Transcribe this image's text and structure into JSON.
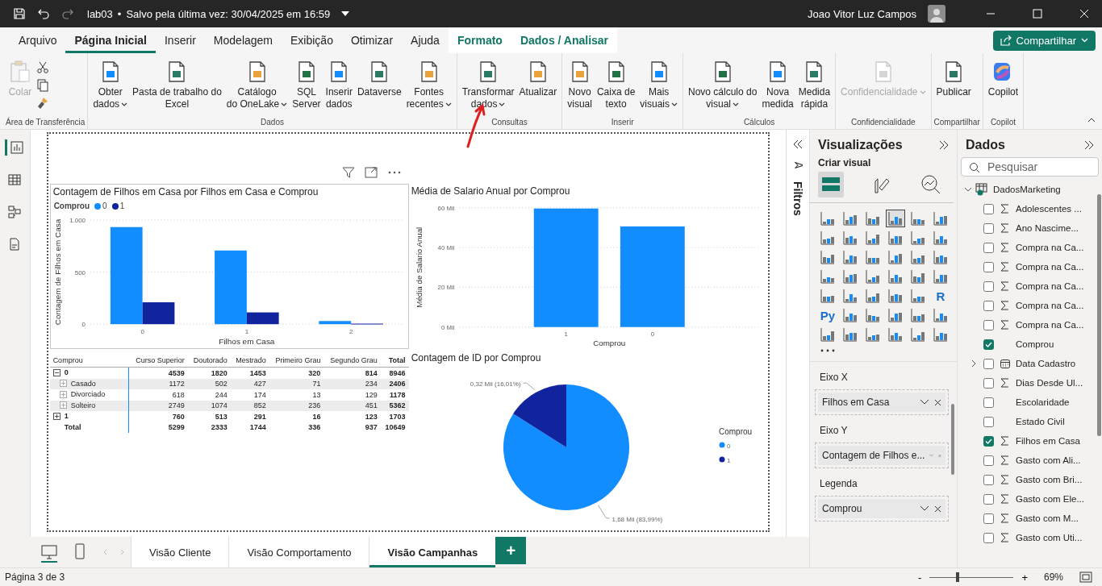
{
  "title_bar": {
    "file_name": "lab03",
    "separator": "•",
    "save_status": "Salvo pela última vez: 30/04/2025 em 16:59",
    "user_name": "Joao Vitor Luz Campos"
  },
  "menu_tabs": [
    {
      "label": "Arquivo",
      "selected": false,
      "kind": "normal"
    },
    {
      "label": "Página Inicial",
      "selected": true,
      "kind": "normal"
    },
    {
      "label": "Inserir",
      "selected": false,
      "kind": "normal"
    },
    {
      "label": "Modelagem",
      "selected": false,
      "kind": "normal"
    },
    {
      "label": "Exibição",
      "selected": false,
      "kind": "normal"
    },
    {
      "label": "Otimizar",
      "selected": false,
      "kind": "normal"
    },
    {
      "label": "Ajuda",
      "selected": false,
      "kind": "normal"
    },
    {
      "label": "Formato",
      "selected": false,
      "kind": "contextual"
    },
    {
      "label": "Dados / Analisar",
      "selected": false,
      "kind": "contextual"
    }
  ],
  "share_button": "Compartilhar",
  "ribbon_groups": [
    {
      "label": "Área de Transferência",
      "kind": "clipboard",
      "items": [
        {
          "label": "Colar",
          "disabled": true,
          "dropdown": false
        }
      ]
    },
    {
      "label": "Dados",
      "kind": "standard",
      "items": [
        {
          "label": "Obter\ndados",
          "disabled": false,
          "dropdown": true
        },
        {
          "label": "Pasta de trabalho do\nExcel",
          "disabled": false,
          "dropdown": false
        },
        {
          "label": "Catálogo\ndo OneLake",
          "disabled": false,
          "dropdown": true
        },
        {
          "label": "SQL\nServer",
          "disabled": false,
          "dropdown": false
        },
        {
          "label": "Inserir\ndados",
          "disabled": false,
          "dropdown": false
        },
        {
          "label": "Dataverse",
          "disabled": false,
          "dropdown": false
        },
        {
          "label": "Fontes\nrecentes",
          "disabled": false,
          "dropdown": true
        }
      ]
    },
    {
      "label": "Consultas",
      "kind": "standard",
      "items": [
        {
          "label": "Transformar\ndados",
          "disabled": false,
          "dropdown": true
        },
        {
          "label": "Atualizar",
          "disabled": false,
          "dropdown": false
        }
      ]
    },
    {
      "label": "Inserir",
      "kind": "standard",
      "items": [
        {
          "label": "Novo\nvisual",
          "disabled": false,
          "dropdown": false
        },
        {
          "label": "Caixa de\ntexto",
          "disabled": false,
          "dropdown": false
        },
        {
          "label": "Mais\nvisuais",
          "disabled": false,
          "dropdown": true
        }
      ]
    },
    {
      "label": "Cálculos",
      "kind": "standard",
      "items": [
        {
          "label": "Novo cálculo do\nvisual",
          "disabled": false,
          "dropdown": true
        },
        {
          "label": "Nova\nmedida",
          "disabled": false,
          "dropdown": false
        },
        {
          "label": "Medida\nrápida",
          "disabled": false,
          "dropdown": false
        }
      ]
    },
    {
      "label": "Confidencialidade",
      "kind": "standard",
      "items": [
        {
          "label": "Confidencialidade",
          "disabled": true,
          "dropdown": true
        }
      ]
    },
    {
      "label": "Compartilhar",
      "kind": "standard",
      "items": [
        {
          "label": "Publicar",
          "disabled": false,
          "dropdown": false
        }
      ]
    },
    {
      "label": "Copilot",
      "kind": "copilot",
      "items": [
        {
          "label": "Copilot",
          "disabled": false,
          "dropdown": false
        }
      ]
    }
  ],
  "view_rail": [
    {
      "selected": true
    },
    {
      "selected": false
    },
    {
      "selected": false
    },
    {
      "selected": false
    }
  ],
  "canvas": {
    "column_chart": {
      "chart_data": {
        "type": "bar",
        "title": "Contagem de Filhos em Casa por Filhos em Casa e Comprou",
        "legend": {
          "title": "Comprou"
        },
        "xlabel": "Filhos em Casa",
        "ylabel": "Contagem de Filhos em Casa",
        "categories": [
          "0",
          "1",
          "2"
        ],
        "series": [
          {
            "name": "0",
            "color": "#118dff",
            "values": [
              932,
              707,
              30
            ]
          },
          {
            "name": "1",
            "color": "#12239e",
            "values": [
              210,
              113,
              5
            ]
          }
        ],
        "ylim": [
          0,
          1000
        ],
        "yticks": [
          {
            "value": 0,
            "label": "0"
          },
          {
            "value": 500,
            "label": "500"
          },
          {
            "value": 1000,
            "label": "1.000"
          }
        ]
      }
    },
    "matrix": {
      "row_header": "Comprou",
      "columns": [
        "Curso Superior",
        "Doutorado",
        "Mestrado",
        "Primeiro Grau",
        "Segundo Grau",
        "Total"
      ],
      "rows": [
        {
          "kind": "group",
          "label": "0",
          "expanded": true,
          "cells": [
            "4539",
            "1820",
            "1453",
            "320",
            "814",
            "8946"
          ]
        },
        {
          "kind": "child",
          "label": "Casado",
          "expanded": false,
          "cells": [
            "1172",
            "502",
            "427",
            "71",
            "234",
            "2406"
          ]
        },
        {
          "kind": "child",
          "label": "Divorciado",
          "expanded": false,
          "cells": [
            "618",
            "244",
            "174",
            "13",
            "129",
            "1178"
          ]
        },
        {
          "kind": "child",
          "label": "Solteiro",
          "expanded": false,
          "cells": [
            "2749",
            "1074",
            "852",
            "236",
            "451",
            "5362"
          ]
        },
        {
          "kind": "group",
          "label": "1",
          "expanded": false,
          "cells": [
            "760",
            "513",
            "291",
            "16",
            "123",
            "1703"
          ]
        },
        {
          "kind": "total",
          "label": "Total",
          "cells": [
            "5299",
            "2333",
            "1744",
            "336",
            "937",
            "10649"
          ]
        }
      ]
    },
    "salary_chart": {
      "chart_data": {
        "type": "bar",
        "title": "Média de Salario Anual por Comprou",
        "xlabel": "Comprou",
        "ylabel": "Média de Salario Anual",
        "categories": [
          "1",
          "0"
        ],
        "values": [
          59.6,
          50.6
        ],
        "color": "#118dff",
        "ylim": [
          0,
          60
        ],
        "yticks": [
          {
            "value": 0,
            "label": "0 Mil"
          },
          {
            "value": 20,
            "label": "20 Mil"
          },
          {
            "value": 40,
            "label": "40 Mil"
          },
          {
            "value": 60,
            "label": "60 Mil"
          }
        ]
      }
    },
    "pie_chart": {
      "chart_data": {
        "type": "pie",
        "title": "Contagem de ID por Comprou",
        "legend": {
          "title": "Comprou"
        },
        "categories": [
          "0",
          "1"
        ],
        "values": [
          1.68,
          0.32
        ],
        "colors": [
          "#118dff",
          "#12239e"
        ],
        "value_labels": [
          "1,68 Mil (83,99%)",
          "0,32 Mil (16,01%)"
        ]
      }
    }
  },
  "filters_pane": {
    "title": "Filtros"
  },
  "visualizations_pane": {
    "title": "Visualizações",
    "subtitle": "Criar visual",
    "tabs": [
      {
        "selected": true
      },
      {
        "selected": false
      },
      {
        "selected": false
      }
    ],
    "visual_types": [
      {
        "selected": false
      },
      {
        "selected": false
      },
      {
        "selected": false
      },
      {
        "selected": true
      },
      {
        "selected": false
      },
      {
        "selected": false
      },
      {
        "selected": false
      },
      {
        "selected": false
      },
      {
        "selected": false
      },
      {
        "selected": false
      },
      {
        "selected": false
      },
      {
        "selected": false
      },
      {
        "selected": false
      },
      {
        "selected": false
      },
      {
        "selected": false
      },
      {
        "selected": false
      },
      {
        "selected": false
      },
      {
        "selected": false
      },
      {
        "selected": false
      },
      {
        "selected": false
      },
      {
        "selected": false
      },
      {
        "selected": false
      },
      {
        "selected": false
      },
      {
        "selected": false
      },
      {
        "selected": false
      },
      {
        "selected": false
      },
      {
        "selected": false
      },
      {
        "selected": false
      },
      {
        "selected": false
      },
      {
        "label": "R",
        "selected": false
      },
      {
        "label": "Py",
        "selected": false
      },
      {
        "selected": false
      },
      {
        "selected": false
      },
      {
        "selected": false
      },
      {
        "selected": false
      },
      {
        "selected": false
      },
      {
        "selected": false
      },
      {
        "selected": false
      },
      {
        "selected": false
      },
      {
        "selected": false
      },
      {
        "selected": false
      },
      {
        "selected": false
      }
    ],
    "wells": [
      {
        "label": "Eixo X",
        "field": "Filhos em Casa"
      },
      {
        "label": "Eixo Y",
        "field": "Contagem de Filhos e..."
      },
      {
        "label": "Legenda",
        "field": "Comprou"
      }
    ]
  },
  "data_pane": {
    "title": "Dados",
    "search": {
      "placeholder": "Pesquisar"
    },
    "table": {
      "name": "DadosMarketing",
      "expanded": true,
      "fields": [
        {
          "name": "Adolescentes ...",
          "kind": "numeric",
          "checked": false
        },
        {
          "name": "Ano Nascime...",
          "kind": "numeric",
          "checked": false
        },
        {
          "name": "Compra na Ca...",
          "kind": "numeric",
          "checked": false
        },
        {
          "name": "Compra na Ca...",
          "kind": "numeric",
          "checked": false
        },
        {
          "name": "Compra na Ca...",
          "kind": "numeric",
          "checked": false
        },
        {
          "name": "Compra na Ca...",
          "kind": "numeric",
          "checked": false
        },
        {
          "name": "Compra na Ca...",
          "kind": "numeric",
          "checked": false
        },
        {
          "name": "Comprou",
          "kind": "text",
          "checked": true
        },
        {
          "name": "Data Cadastro",
          "kind": "date",
          "checked": false
        },
        {
          "name": "Dias Desde Ul...",
          "kind": "numeric",
          "checked": false
        },
        {
          "name": "Escolaridade",
          "kind": "text",
          "checked": false
        },
        {
          "name": "Estado Civil",
          "kind": "text",
          "checked": false
        },
        {
          "name": "Filhos em Casa",
          "kind": "numeric",
          "checked": true
        },
        {
          "name": "Gasto com Ali...",
          "kind": "numeric",
          "checked": false
        },
        {
          "name": "Gasto com Bri...",
          "kind": "numeric",
          "checked": false
        },
        {
          "name": "Gasto com Ele...",
          "kind": "numeric",
          "checked": false
        },
        {
          "name": "Gasto com M...",
          "kind": "numeric",
          "checked": false
        },
        {
          "name": "Gasto com Uti...",
          "kind": "numeric",
          "checked": false
        }
      ]
    }
  },
  "page_tabs": [
    {
      "label": "Visão Cliente",
      "selected": false
    },
    {
      "label": "Visão Comportamento",
      "selected": false
    },
    {
      "label": "Visão Campanhas",
      "selected": true
    }
  ],
  "layout_views": [
    {
      "selected": true
    },
    {
      "selected": false
    }
  ],
  "add_page_button": "+",
  "status_bar": {
    "page": "Página 3 de 3",
    "zoom_out": "-",
    "zoom_in": "+",
    "zoom": {
      "level": 0.33
    },
    "zoom_label": "69%"
  }
}
